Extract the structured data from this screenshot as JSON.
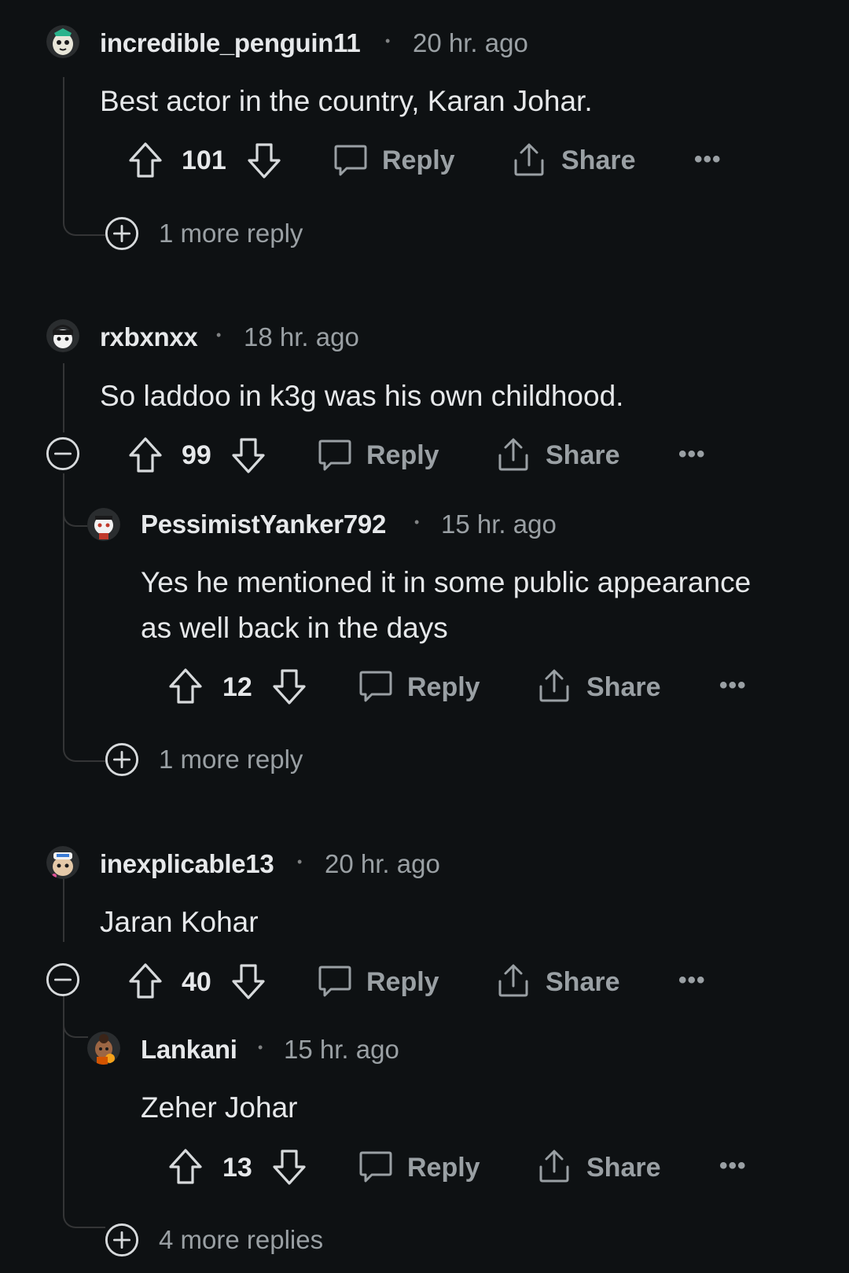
{
  "comments": [
    {
      "username": "incredible_penguin11",
      "time": "20 hr. ago",
      "body": [
        "Best actor in the country, Karan Johar."
      ],
      "votes": "101",
      "reply_label": "Reply",
      "share_label": "Share",
      "more_replies": "1 more reply"
    },
    {
      "username": "rxbxnxx",
      "time": "18 hr. ago",
      "body": [
        "So laddoo in k3g was his own childhood."
      ],
      "votes": "99",
      "reply_label": "Reply",
      "share_label": "Share",
      "reply": {
        "username": "PessimistYanker792",
        "time": "15 hr. ago",
        "body": [
          "Yes he mentioned it in some public appearance",
          "as well back in the days"
        ],
        "votes": "12",
        "reply_label": "Reply",
        "share_label": "Share"
      },
      "more_replies": "1 more reply"
    },
    {
      "username": "inexplicable13",
      "time": "20 hr. ago",
      "body": [
        "Jaran Kohar"
      ],
      "votes": "40",
      "reply_label": "Reply",
      "share_label": "Share",
      "reply": {
        "username": "Lankani",
        "time": "15 hr. ago",
        "body": [
          "Zeher Johar"
        ],
        "votes": "13",
        "reply_label": "Reply",
        "share_label": "Share"
      },
      "more_replies": "4 more replies"
    }
  ],
  "icons": {
    "upvote": "upvote-arrow-icon",
    "downvote": "downvote-arrow-icon",
    "reply": "speech-bubble-icon",
    "share": "share-upload-icon",
    "more": "more-options-icon",
    "expand": "plus-circle-icon",
    "collapse": "minus-circle-icon"
  },
  "colors": {
    "background": "#0e1113",
    "text": "#e6e8ea",
    "muted": "#9aa0a4",
    "thread_line": "#343536"
  }
}
